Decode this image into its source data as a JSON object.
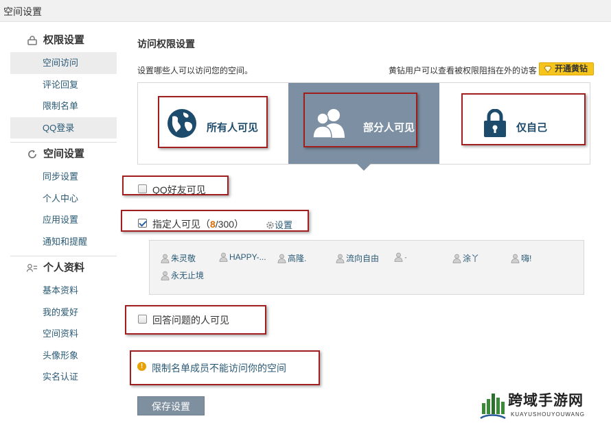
{
  "topbar": {
    "title": "空间设置"
  },
  "sidebar": {
    "sections": [
      {
        "title": "权限设置",
        "icon": "lock-icon",
        "items": [
          "空间访问",
          "评论回复",
          "限制名单",
          "QQ登录"
        ]
      },
      {
        "title": "空间设置",
        "icon": "sync-icon",
        "items": [
          "同步设置",
          "个人中心",
          "应用设置",
          "通知和提醒"
        ]
      },
      {
        "title": "个人资料",
        "icon": "profile-icon",
        "items": [
          "基本资料",
          "我的爱好",
          "空间资料",
          "头像形象",
          "实名认证"
        ]
      }
    ],
    "active_items": [
      "空间访问",
      "QQ登录"
    ]
  },
  "main": {
    "title": "访问权限设置",
    "description": "设置哪些人可以访问您的空间。",
    "vip_hint": "黄钻用户可以查看被权限阻挡在外的访客",
    "vip_button": "开通黄钻",
    "options": [
      {
        "label": "所有人可见",
        "icon": "globe-icon",
        "selected": false
      },
      {
        "label": "部分人可见",
        "icon": "people-icon",
        "selected": true
      },
      {
        "label": "仅自己",
        "icon": "padlock-icon",
        "selected": false
      }
    ],
    "qq_friends": {
      "label": "QQ好友可见",
      "checked": false
    },
    "specific": {
      "label": "指定人可见",
      "paren_open": "（",
      "count": "8",
      "slash_max": "/300",
      "paren_close": "）",
      "settings_label": "设置",
      "checked": true
    },
    "friends": [
      "朱灵敬",
      "HAPPY-...",
      "高隆.",
      "流向自由",
      "·",
      "涂丫",
      "嗨!",
      "永无止境"
    ],
    "answer": {
      "label": "回答问题的人可见",
      "checked": false
    },
    "warning": "限制名单成员不能访问你的空间",
    "save_button": "保存设置"
  },
  "watermark": {
    "text": "跨域手游网",
    "sub": "KUAYUSHOUYOUWANG"
  },
  "colors": {
    "selected_option_bg": "#7d90a3",
    "annotation_red": "#a01e1e",
    "link_blue": "#2a5a75",
    "count_orange": "#e06b00",
    "vip_yellow": "#f5c51e"
  }
}
